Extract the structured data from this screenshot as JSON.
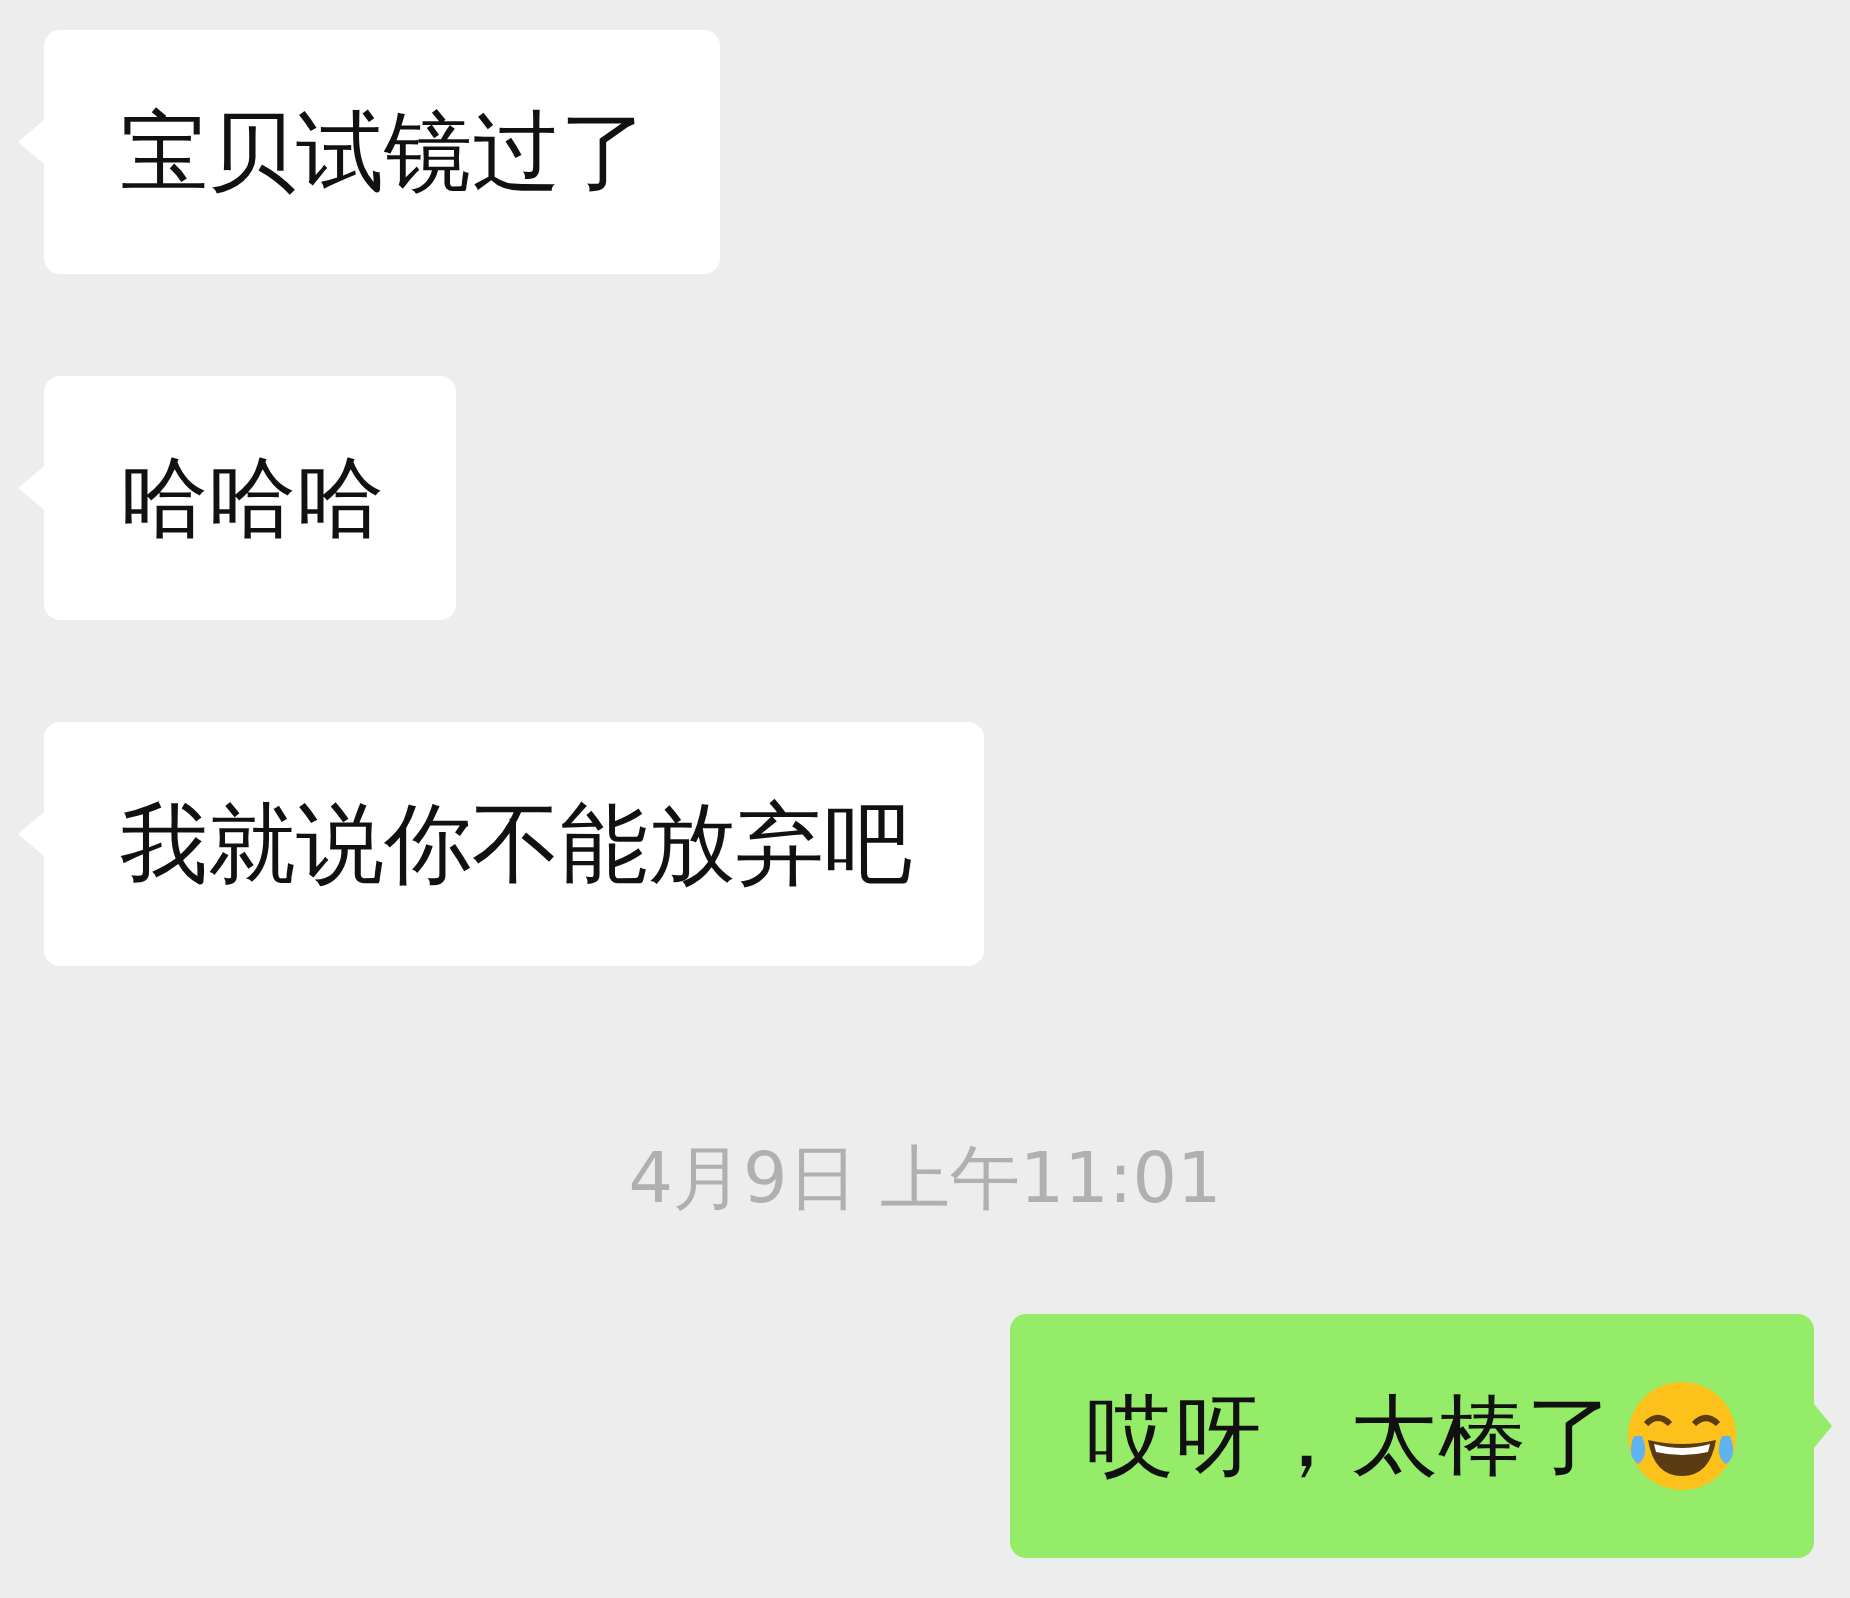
{
  "messages": [
    {
      "kind": "received",
      "text": "宝贝试镜过了"
    },
    {
      "kind": "received",
      "text": "哈哈哈"
    },
    {
      "kind": "received",
      "text": "我就说你不能放弃吧"
    },
    {
      "kind": "time",
      "text": "4月9日 上午11:01"
    },
    {
      "kind": "sent",
      "text": "哎呀，太棒了",
      "trailing_emoji": true
    }
  ]
}
